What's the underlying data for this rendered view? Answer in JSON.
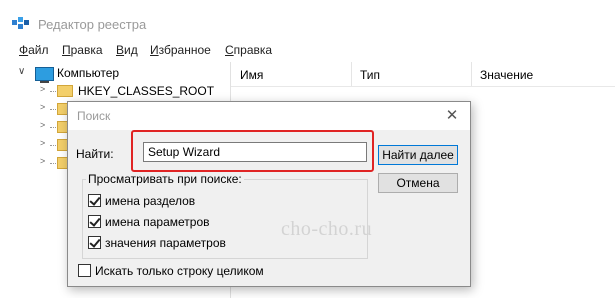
{
  "window": {
    "title": "Редактор реестра",
    "app_icon": "registry-editor-icon"
  },
  "menu": [
    {
      "key": "Ф",
      "rest": "айл"
    },
    {
      "key": "П",
      "rest": "равка"
    },
    {
      "key": "В",
      "rest": "ид"
    },
    {
      "key": "И",
      "rest": "збранное"
    },
    {
      "key": "С",
      "rest": "правка"
    }
  ],
  "tree": {
    "root_label": "Компьютер",
    "children": [
      "HKEY_CLASSES_ROOT",
      "",
      "",
      "",
      ""
    ]
  },
  "list": {
    "columns": [
      "Имя",
      "Тип",
      "Значение"
    ]
  },
  "dialog": {
    "title": "Поиск",
    "find_label": "Найти:",
    "find_value": "Setup Wizard",
    "find_next_label": "Найти далее",
    "cancel_label": "Отмена",
    "group_label": "Просматривать при поиске:",
    "options": [
      {
        "label": "имена разделов",
        "checked": true
      },
      {
        "label": "имена параметров",
        "checked": true
      },
      {
        "label": "значения параметров",
        "checked": true
      }
    ],
    "whole_string": {
      "label": "Искать только строку целиком",
      "checked": false
    },
    "highlight_color": "#e02424"
  },
  "watermark": "cho-cho.ru"
}
